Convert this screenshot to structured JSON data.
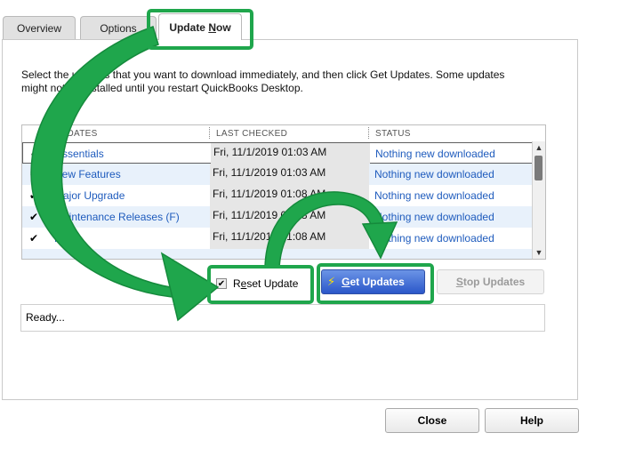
{
  "tabs": [
    {
      "label": "Overview"
    },
    {
      "label": "Options"
    },
    {
      "label_pre": "Update ",
      "label_u": "N",
      "label_post": "ow"
    }
  ],
  "instructions": "Select the updates that you want to download immediately, and then click Get Updates. Some updates might not be installed until you restart QuickBooks Desktop.",
  "columns": {
    "updates": "UPDATES",
    "last_checked": "LAST CHECKED",
    "status": "STATUS"
  },
  "rows": [
    {
      "check": "✔",
      "name": "Essentials",
      "date": "Fri, 11/1/2019 01:03 AM",
      "status": "Nothing new downloaded"
    },
    {
      "check": "✔",
      "name": "New Features",
      "date": "Fri, 11/1/2019 01:03 AM",
      "status": "Nothing new downloaded"
    },
    {
      "check": "✔",
      "name": "Major Upgrade",
      "date": "Fri, 11/1/2019 01:08 AM",
      "status": "Nothing new downloaded"
    },
    {
      "check": "✔",
      "name": "Maintenance Releases (F)",
      "date": "Fri, 11/1/2019 01:08 AM",
      "status": "Nothing new downloaded"
    },
    {
      "check": "✔",
      "name": "P",
      "date": "Fri, 11/1/2019 01:08 AM",
      "status": "Nothing new downloaded"
    }
  ],
  "reset": {
    "label_pre": "R",
    "label_u": "e",
    "label_post": "set Update",
    "checked": "✔"
  },
  "get_updates": {
    "icon": "⚡",
    "label_u": "G",
    "label_post": "et Updates"
  },
  "stop_updates": {
    "label_u": "S",
    "label_post": "top Updates"
  },
  "status_text": "Ready...",
  "close_label": "Close",
  "help_label": "Help",
  "colors": {
    "highlight": "#1fa64c",
    "link": "#1e5bbd",
    "button": "#2b57c9"
  }
}
